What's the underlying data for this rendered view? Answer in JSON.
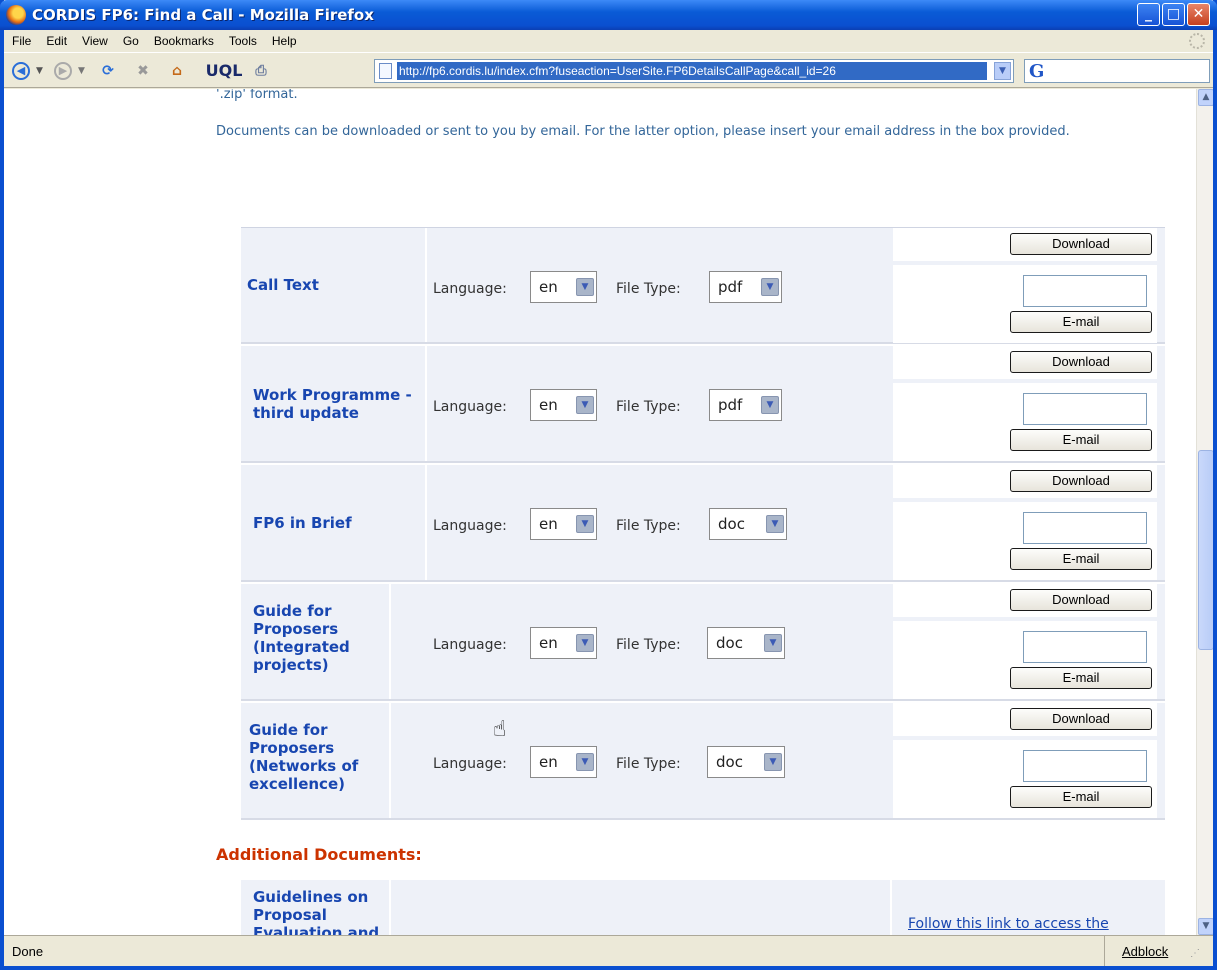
{
  "window": {
    "title": "CORDIS FP6: Find a Call - Mozilla Firefox"
  },
  "menu": [
    "File",
    "Edit",
    "View",
    "Go",
    "Bookmarks",
    "Tools",
    "Help"
  ],
  "toolbar": {
    "url": "http://fp6.cordis.lu/index.cfm?fuseaction=UserSite.FP6DetailsCallPage&call_id=26",
    "search_glyph": "G"
  },
  "page": {
    "intro_fragment": "'.zip' format.",
    "instructions": "Documents can be downloaded or sent to you by email. For the latter option, please insert your email address in the box provided.",
    "language_label": "Language:",
    "filetype_label": "File Type:",
    "download_label": "Download",
    "email_label": "E-mail",
    "documents": [
      {
        "name": "Call Text",
        "language": "en",
        "filetype": "pdf"
      },
      {
        "name": "Work Programme - third update",
        "language": "en",
        "filetype": "pdf"
      },
      {
        "name": "FP6 in Brief",
        "language": "en",
        "filetype": "doc"
      },
      {
        "name": "Guide for Proposers (Integrated projects)",
        "language": "en",
        "filetype": "doc"
      },
      {
        "name": "Guide for Proposers (Networks of excellence)",
        "language": "en",
        "filetype": "doc"
      }
    ],
    "additional_heading": "Additional Documents:",
    "additional": {
      "name": "Guidelines on Proposal Evaluation and",
      "link_text": "Follow this link to access the"
    }
  },
  "status": {
    "text": "Done",
    "adblock": "Adblock"
  }
}
